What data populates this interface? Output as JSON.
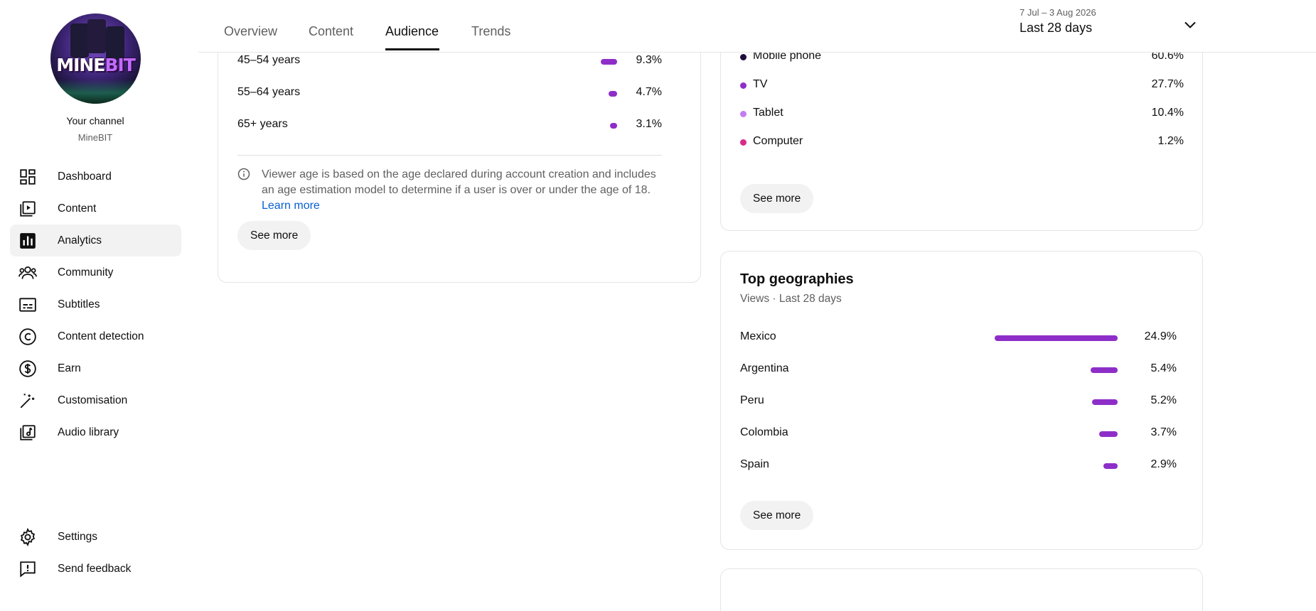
{
  "sidebar": {
    "avatar_text_a": "MINE",
    "avatar_text_b": "BIT",
    "channel_title": "Your channel",
    "channel_name": "MineBIT",
    "items": [
      {
        "label": "Dashboard",
        "icon": "dashboard-icon"
      },
      {
        "label": "Content",
        "icon": "content-icon"
      },
      {
        "label": "Analytics",
        "icon": "analytics-icon",
        "active": true
      },
      {
        "label": "Community",
        "icon": "community-icon"
      },
      {
        "label": "Subtitles",
        "icon": "subtitles-icon"
      },
      {
        "label": "Content detection",
        "icon": "copyright-icon"
      },
      {
        "label": "Earn",
        "icon": "earn-icon"
      },
      {
        "label": "Customisation",
        "icon": "magic-wand-icon"
      },
      {
        "label": "Audio library",
        "icon": "audio-library-icon"
      }
    ],
    "footer": [
      {
        "label": "Settings",
        "icon": "gear-icon"
      },
      {
        "label": "Send feedback",
        "icon": "feedback-icon"
      }
    ]
  },
  "tabs": [
    {
      "label": "Overview"
    },
    {
      "label": "Content"
    },
    {
      "label": "Audience",
      "active": true
    },
    {
      "label": "Trends"
    }
  ],
  "date": {
    "range": "7 Jul – 3 Aug 2026",
    "label": "Last 28 days"
  },
  "age_card": {
    "rows": [
      {
        "label": "45–54 years",
        "value": "9.3%",
        "pct": 9.3
      },
      {
        "label": "55–64 years",
        "value": "4.7%",
        "pct": 4.7
      },
      {
        "label": "65+ years",
        "value": "3.1%",
        "pct": 3.1
      }
    ],
    "note": "Viewer age is based on the age declared during account creation and includes an age estimation model to determine if a user is over or under the age of 18.",
    "learn_more": "Learn more",
    "see_more": "See more"
  },
  "device_card": {
    "rows": [
      {
        "label": "Mobile phone",
        "value": "60.6%",
        "color": "#1f0c3b"
      },
      {
        "label": "TV",
        "value": "27.7%",
        "color": "#8e2ec8"
      },
      {
        "label": "Tablet",
        "value": "10.4%",
        "color": "#c27ef0"
      },
      {
        "label": "Computer",
        "value": "1.2%",
        "color": "#d62c8a"
      }
    ],
    "see_more": "See more"
  },
  "geo_card": {
    "title": "Top geographies",
    "subtitle": "Views · Last 28 days",
    "rows": [
      {
        "label": "Mexico",
        "value": "24.9%",
        "pct": 24.9
      },
      {
        "label": "Argentina",
        "value": "5.4%",
        "pct": 5.4
      },
      {
        "label": "Peru",
        "value": "5.2%",
        "pct": 5.2
      },
      {
        "label": "Colombia",
        "value": "3.7%",
        "pct": 3.7
      },
      {
        "label": "Spain",
        "value": "2.9%",
        "pct": 2.9
      }
    ],
    "see_more": "See more"
  },
  "colors": {
    "accent": "#8e2ec8",
    "link": "#065fd4"
  }
}
